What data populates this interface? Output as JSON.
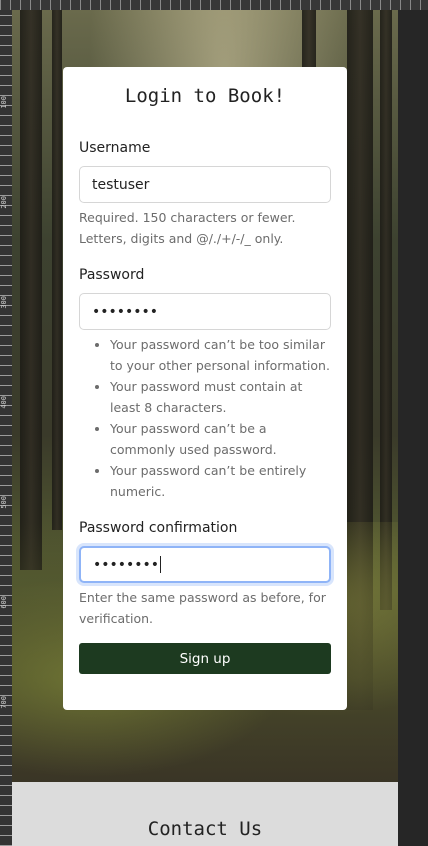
{
  "card": {
    "title": "Login to Book!",
    "username": {
      "label": "Username",
      "value": "testuser",
      "help": "Required. 150 characters or fewer. Letters, digits and @/./+/-/_ only."
    },
    "password": {
      "label": "Password",
      "value": "••••••••",
      "rules": [
        "Your password can’t be too similar to your other personal information.",
        "Your password must contain at least 8 characters.",
        "Your password can’t be a commonly used password.",
        "Your password can’t be entirely numeric."
      ]
    },
    "password_confirmation": {
      "label": "Password confirmation",
      "value": "••••••••",
      "help": "Enter the same password as before, for verification."
    },
    "submit_label": "Sign up"
  },
  "footer": {
    "title": "Contact Us"
  },
  "colors": {
    "button": "#1d3a20",
    "focus_ring": "#8fb4f7",
    "footer": "#dcdcdc"
  },
  "ruler": {
    "ticks": [
      "100",
      "200",
      "300",
      "400",
      "500",
      "600",
      "700"
    ]
  }
}
